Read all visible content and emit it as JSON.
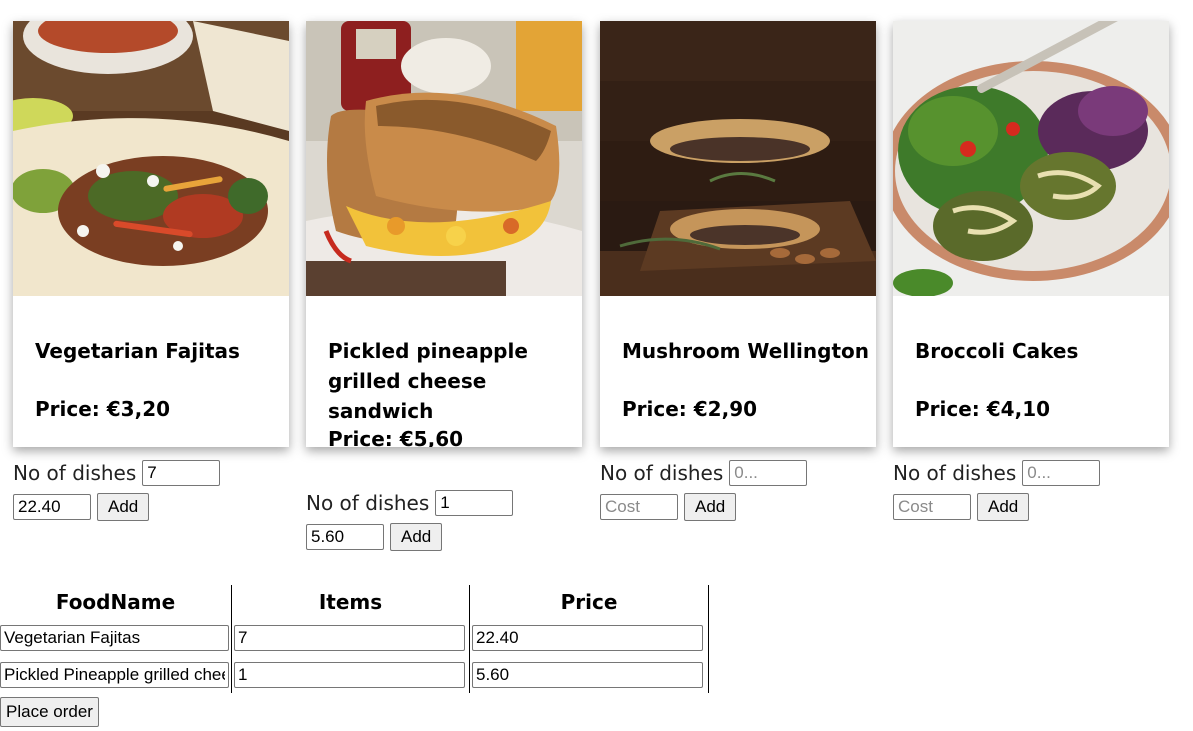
{
  "products": [
    {
      "title": "Vegetarian Fajitas",
      "price": "Price: €3,20",
      "dishes_label": "No of dishes",
      "dishes_value": "7",
      "dishes_placeholder": "0...",
      "cost_value": "22.40",
      "cost_placeholder": "Cost",
      "add_label": "Add",
      "photo_icon": "fajitas-photo"
    },
    {
      "title": "Pickled pineapple grilled cheese sandwich",
      "price": "Price: €5,60",
      "dishes_label": "No of dishes",
      "dishes_value": "1",
      "dishes_placeholder": "0...",
      "cost_value": "5.60",
      "cost_placeholder": "Cost",
      "add_label": "Add",
      "photo_icon": "grilled-cheese-photo"
    },
    {
      "title": "Mushroom Wellington",
      "price": "Price: €2,90",
      "dishes_label": "No of dishes",
      "dishes_value": "",
      "dishes_placeholder": "0...",
      "cost_value": "",
      "cost_placeholder": "Cost",
      "add_label": "Add",
      "photo_icon": "wellington-photo"
    },
    {
      "title": "Broccoli Cakes",
      "price": "Price: €4,10",
      "dishes_label": "No of dishes",
      "dishes_value": "",
      "dishes_placeholder": "0...",
      "cost_value": "",
      "cost_placeholder": "Cost",
      "add_label": "Add",
      "photo_icon": "broccoli-cakes-photo"
    }
  ],
  "order_table": {
    "headers": [
      "FoodName",
      "Items",
      "Price"
    ],
    "rows": [
      [
        "Vegetarian Fajitas",
        "7",
        "22.40"
      ],
      [
        "Pickled Pineapple grilled cheese sandwich",
        "1",
        "5.60"
      ]
    ]
  },
  "place_order_label": "Place order"
}
